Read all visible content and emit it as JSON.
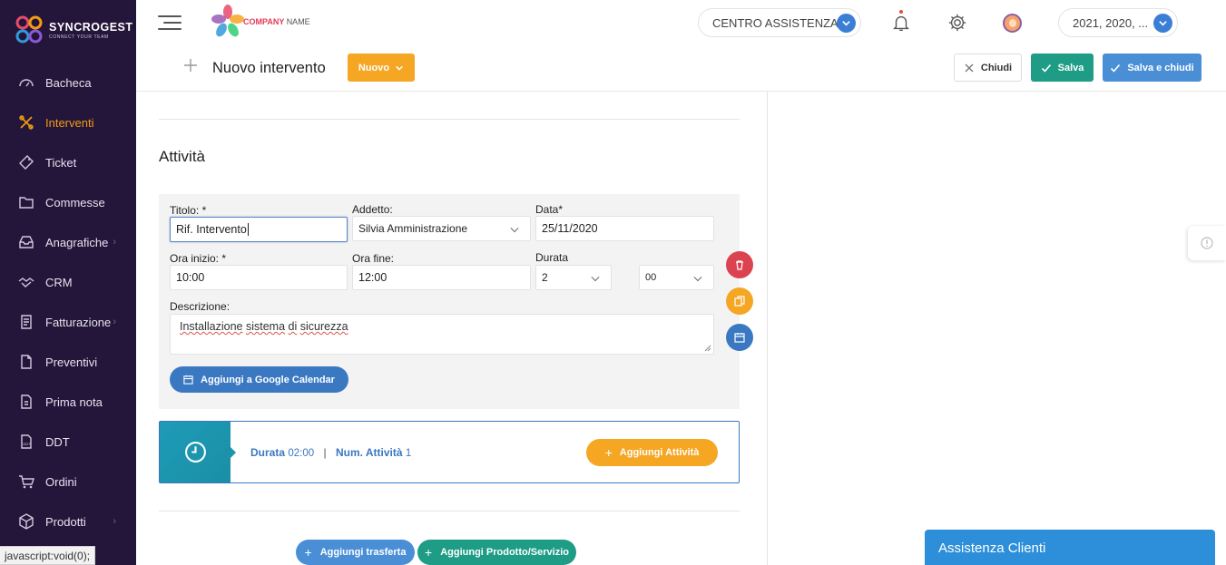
{
  "brand": {
    "name": "SYNCROGEST",
    "tagline": "CONNECT YOUR TEAM"
  },
  "sidebar": {
    "items": [
      {
        "label": "Bacheca",
        "icon": "dashboard-icon",
        "active": false
      },
      {
        "label": "Interventi",
        "icon": "tools-icon",
        "active": true
      },
      {
        "label": "Ticket",
        "icon": "ticket-icon",
        "active": false
      },
      {
        "label": "Commesse",
        "icon": "folder-icon",
        "active": false
      },
      {
        "label": "Anagrafiche",
        "icon": "inbox-icon",
        "active": false,
        "caret": "›"
      },
      {
        "label": "CRM",
        "icon": "handshake-icon",
        "active": false
      },
      {
        "label": "Fatturazione",
        "icon": "invoice-icon",
        "active": false,
        "caret": "›"
      },
      {
        "label": "Preventivi",
        "icon": "quote-icon",
        "active": false
      },
      {
        "label": "Prima nota",
        "icon": "note-icon",
        "active": false
      },
      {
        "label": "DDT",
        "icon": "ddt-icon",
        "active": false
      },
      {
        "label": "Ordini",
        "icon": "cart-icon",
        "active": false
      },
      {
        "label": "Prodotti",
        "icon": "box-icon",
        "active": false,
        "caret": "›"
      }
    ]
  },
  "topbar": {
    "company_logo_text": "COMPANY",
    "company_logo_text2": "NAME",
    "help_center": "CENTRO ASSISTENZA",
    "years": "2021, 2020, ..."
  },
  "actionbar": {
    "title": "Nuovo intervento",
    "new_label": "Nuovo",
    "close_label": "Chiudi",
    "save_label": "Salva",
    "save_close_label": "Salva e chiudi"
  },
  "activity": {
    "section_title": "Attività",
    "title_label": "Titolo: *",
    "title_value": "Rif. Intervento",
    "assignee_label": "Addetto:",
    "assignee_value": "Silvia Amministrazione",
    "date_label": "Data*",
    "date_value": "25/11/2020",
    "start_label": "Ora inizio: *",
    "start_value": "10:00",
    "end_label": "Ora fine:",
    "end_value": "12:00",
    "duration_label": "Durata",
    "duration_hours": "2",
    "duration_minutes": "00",
    "description_label": "Descrizione:",
    "description_words": [
      "Installazione",
      "sistema",
      "di",
      "sicurezza"
    ],
    "gcal_button": "Aggiungi a Google Calendar"
  },
  "summary": {
    "duration_label": "Durata",
    "duration_value": "02:00",
    "separator": "|",
    "count_label": "Num. Attività",
    "count_value": "1",
    "add_button": "Aggiungi Attività"
  },
  "bottom": {
    "add_travel": "Aggiungi trasferta",
    "add_product": "Aggiungi Prodotto/Servizio"
  },
  "assist_widget": "Assistenza Clienti",
  "status_bar": "javascript:void(0);",
  "colors": {
    "sidebar_bg": "#24163a",
    "accent_orange": "#f5a623",
    "accent_teal": "#1e9c86",
    "accent_blue": "#4a8fd6",
    "danger": "#dc4350"
  }
}
